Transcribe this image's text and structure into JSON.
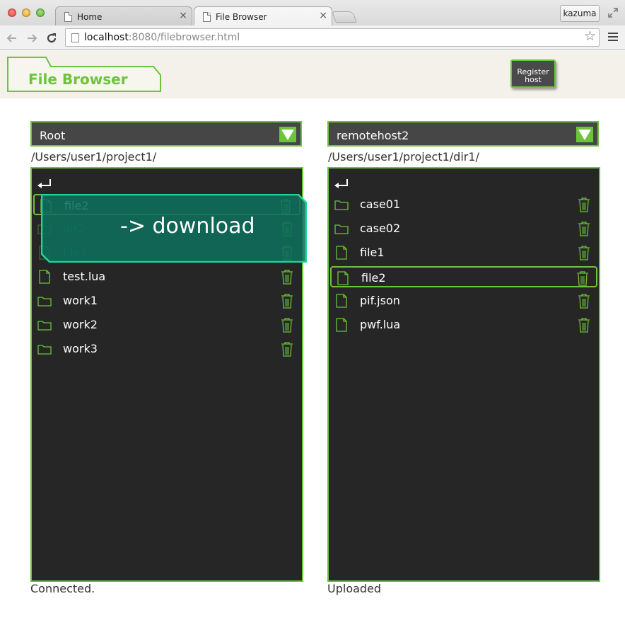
{
  "browser": {
    "tabs": [
      {
        "label": "Home"
      },
      {
        "label": "File Browser"
      }
    ],
    "user": "kazuma",
    "url": {
      "host": "localhost",
      "rest": ":8080/filebrowser.html"
    }
  },
  "app": {
    "title": "File Browser",
    "register_button": {
      "line1": "Register",
      "line2": "host"
    },
    "accent_color": "#6cc43a",
    "panel_color": "#262626"
  },
  "left_pane": {
    "source": "Root",
    "path": "/Users/user1/project1/",
    "status": "Connected.",
    "items": [
      {
        "name": "file2",
        "type": "file",
        "selected": true
      },
      {
        "name": "dir2",
        "type": "folder",
        "obscured": true
      },
      {
        "name": "file1",
        "type": "file",
        "obscured": true
      },
      {
        "name": "test.lua",
        "type": "file"
      },
      {
        "name": "work1",
        "type": "folder"
      },
      {
        "name": "work2",
        "type": "folder"
      },
      {
        "name": "work3",
        "type": "folder"
      }
    ]
  },
  "right_pane": {
    "source": "remotehost2",
    "path": "/Users/user1/project1/dir1/",
    "status": "Uploaded",
    "items": [
      {
        "name": "case01",
        "type": "folder"
      },
      {
        "name": "case02",
        "type": "folder"
      },
      {
        "name": "file1",
        "type": "file"
      },
      {
        "name": "file2",
        "type": "file",
        "selected": true
      },
      {
        "name": "pif.json",
        "type": "file"
      },
      {
        "name": "pwf.lua",
        "type": "file"
      }
    ]
  },
  "drag": {
    "label": "-> download"
  }
}
